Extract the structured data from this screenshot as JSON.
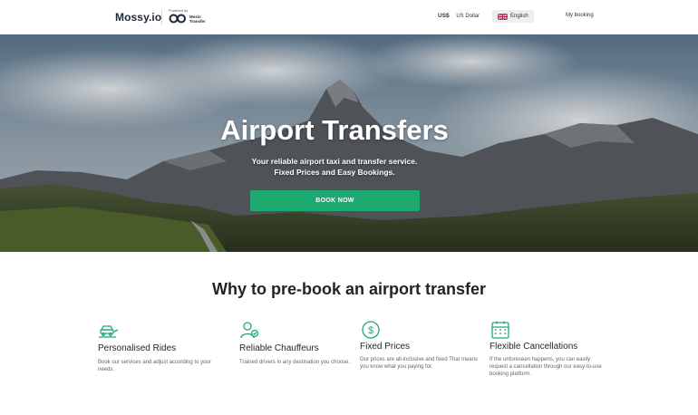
{
  "header": {
    "brand": "Mossy.io",
    "powered_by": "Powered by",
    "partner_line1": "Mozio",
    "partner_line2": "Transfer",
    "currency_symbol": "US$",
    "currency_label": "US Dollar",
    "language_label": "English",
    "my_booking": "My booking"
  },
  "hero": {
    "title": "Airport Transfers",
    "subtitle_line1": "Your reliable airport taxi and transfer service.",
    "subtitle_line2": "Fixed Prices and Easy Bookings.",
    "cta": "BOOK NOW"
  },
  "why": {
    "title": "Why to pre-book an airport transfer",
    "features": [
      {
        "icon": "car-hands-icon",
        "title": "Personalised Rides",
        "desc": "Book our services and adjust according to your needs."
      },
      {
        "icon": "chauffeur-icon",
        "title": "Reliable Chauffeurs",
        "desc": "Trained drivers in any destination you choose."
      },
      {
        "icon": "dollar-icon",
        "title": "Fixed Prices",
        "desc": "Our prices are all-inclusive and fixed That means you know what you paying for."
      },
      {
        "icon": "calendar-icon",
        "title": "Flexible Cancellations",
        "desc": "If the unforeseen happens, you can easily request a cancellation through our easy-to-use booking platform."
      }
    ]
  },
  "colors": {
    "accent": "#1ea971",
    "text_dark": "#1f2328"
  }
}
